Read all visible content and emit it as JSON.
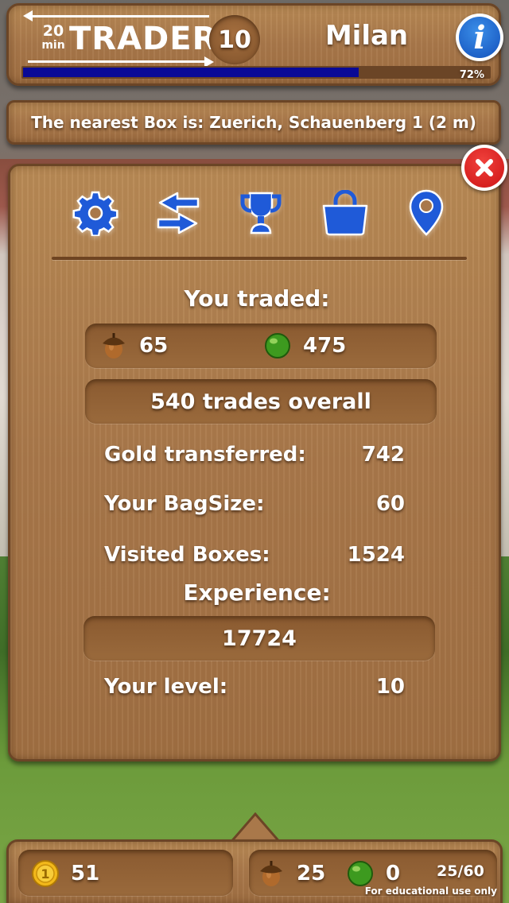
{
  "app": {
    "logo": {
      "number": "20",
      "unit": "min",
      "word": "TRADER"
    },
    "player_level": "10",
    "player_name": "Milan",
    "xp_percent_label": "72%",
    "xp_progress": 0.72
  },
  "banner": {
    "text": "The nearest Box is: Zuerich, Schauenberg 1 (2 m)"
  },
  "tabs": [
    {
      "icon": "gear-icon"
    },
    {
      "icon": "swap-arrows-icon"
    },
    {
      "icon": "trophy-icon"
    },
    {
      "icon": "bag-icon"
    },
    {
      "icon": "map-pin-icon"
    }
  ],
  "stats": {
    "you_traded_label": "You traded:",
    "acorn_count": "65",
    "apple_count": "475",
    "overall_text": "540 trades overall",
    "gold_label": "Gold transferred:",
    "gold_value": "742",
    "bagsize_label": "Your BagSize:",
    "bagsize_value": "60",
    "visited_label": "Visited Boxes:",
    "visited_value": "1524",
    "experience_label": "Experience:",
    "experience_value": "17724",
    "level_label": "Your level:",
    "level_value": "10"
  },
  "bottom": {
    "gold": "51",
    "acorns": "25",
    "apples": "0",
    "bag": "25/60",
    "note": "For educational use only"
  },
  "colors": {
    "wood": "#a9784a",
    "wood_border": "#6b4526",
    "icon_blue": "#1f5ad8",
    "xp_bar": "#0a0a96",
    "close_red": "#d61f1f",
    "info_blue": "#1f63c9"
  }
}
